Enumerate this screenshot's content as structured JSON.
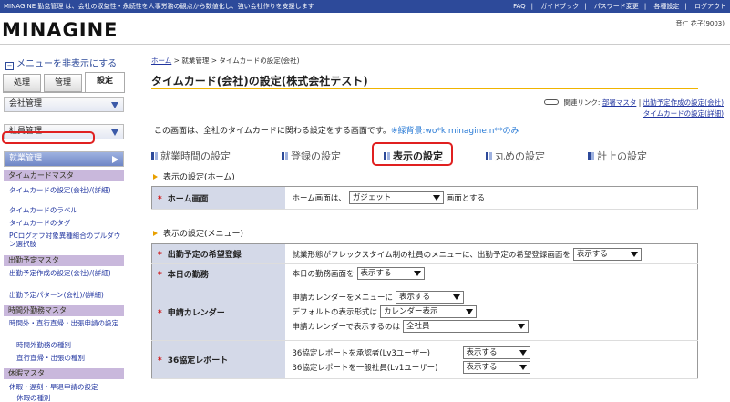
{
  "topbar": {
    "tagline": "MINAGINE 勤怠管理 は、会社の収益性・永続性を人事労務の観点から数値化し、強い会社作りを支援します",
    "links": [
      "FAQ",
      "ガイドブック",
      "パスワード変更",
      "各種設定",
      "ログアウト"
    ]
  },
  "header": {
    "logo": "MINAGINE",
    "user": "音仁 花子(9003)"
  },
  "sidebar": {
    "hide_menu": "メニューを非表示にする",
    "tabs": [
      "処理",
      "管理",
      "設定"
    ],
    "categories": [
      {
        "label": "会社管理"
      },
      {
        "label": "社員管理"
      },
      {
        "label": "就業管理"
      }
    ],
    "sections": [
      {
        "title": "タイムカードマスタ",
        "links": [
          "タイムカードの設定(会社)/(詳細)",
          "タイムカードのラベル",
          "タイムカードのタグ",
          "PCログオフ対象異種組合のプルダウン選択肢"
        ]
      },
      {
        "title": "出勤予定マスタ",
        "links": [
          "出勤予定作成の設定(会社)/(詳細)",
          "出勤予定パターン(会社)/(詳細)"
        ]
      },
      {
        "title": "時間外勤務マスタ",
        "links": [
          "時間外・直行直帰・出張申請の設定",
          "時間外勤務の種別",
          "直行直帰・出張の種別"
        ]
      },
      {
        "title": "休暇マスタ",
        "links": [
          "休暇・遅刻・早退申請の設定",
          "休暇の種別"
        ]
      }
    ]
  },
  "breadcrumb": [
    "ホーム",
    "就業管理",
    "タイムカードの設定(会社)"
  ],
  "page_title": "タイムカード(会社)の設定(株式会社テスト)",
  "related": {
    "label": "関連リンク:",
    "links": [
      "部署マスタ",
      "出勤予定作成の設定(会社)",
      "タイムカードの設定(詳細)"
    ]
  },
  "description": "この画面は、全社のタイムカードに関わる設定をする画面です。",
  "description_note": "※緑背景:wo*k.minagine.n**のみ",
  "tabs": [
    "就業時間の設定",
    "登録の設定",
    "表示の設定",
    "丸めの設定",
    "計上の設定"
  ],
  "section_home": {
    "title": "表示の設定(ホーム)",
    "row": {
      "label": "ホーム画面",
      "text_before": "ホーム画面は、",
      "select": "ガジェット",
      "text_after": "画面とする"
    }
  },
  "section_menu": {
    "title": "表示の設定(メニュー)",
    "rows": {
      "shukkin": {
        "label": "出勤予定の希望登録",
        "text": "就業形態がフレックスタイム制の社員のメニューに、出勤予定の希望登録画面を",
        "select": "表示する"
      },
      "honjitsu": {
        "label": "本日の勤務",
        "text": "本日の勤務画面を",
        "select": "表示する"
      },
      "calendar": {
        "label": "申請カレンダー",
        "line1": "申請カレンダーをメニューに",
        "select1": "表示する",
        "line2": "デフォルトの表示形式は",
        "select2": "カレンダー表示",
        "line3": "申請カレンダーで表示するのは",
        "select3": "全社員"
      },
      "kyotei": {
        "label": "36協定レポート",
        "line1": "36協定レポートを承認者(Lv3ユーザー)",
        "select1": "表示する",
        "line2": "36協定レポートを一般社員(Lv1ユーザー)",
        "select2": "表示する"
      }
    }
  },
  "colors": {
    "brand": "#2d4a9a",
    "accent": "#f0b400",
    "highlight": "#e02020",
    "label_bg": "#d4d9e8"
  }
}
